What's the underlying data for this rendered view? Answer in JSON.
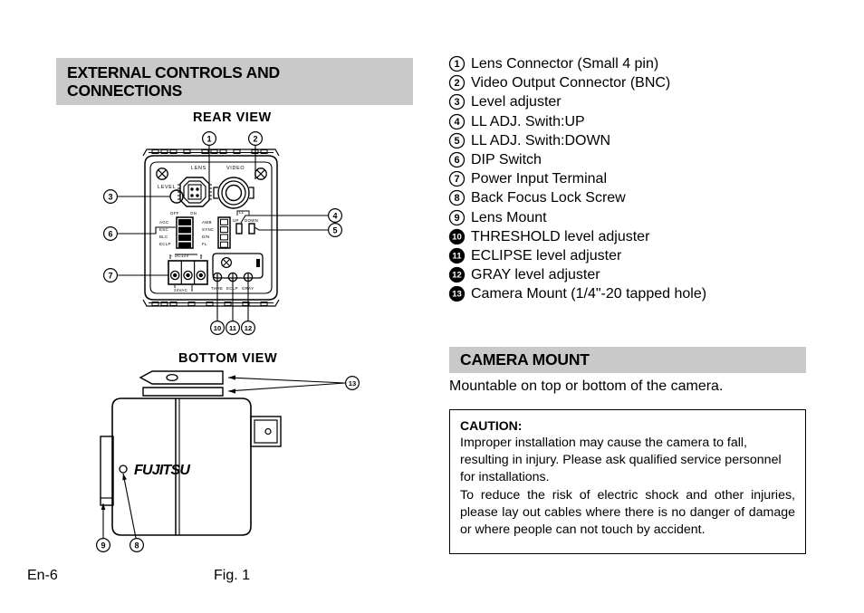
{
  "sections": {
    "external_controls": {
      "title": "EXTERNAL CONTROLS AND\nCONNECTIONS"
    },
    "camera_mount": {
      "title": "CAMERA MOUNT",
      "description": "Mountable on top or bottom of the camera."
    }
  },
  "views": {
    "rear": {
      "caption": "REAR  VIEW"
    },
    "bottom": {
      "caption": "BOTTOM  VIEW"
    }
  },
  "parts_list": [
    {
      "num": "1",
      "label": "Lens Connector (Small 4 pin)"
    },
    {
      "num": "2",
      "label": "Video Output Connector (BNC)"
    },
    {
      "num": "3",
      "label": "Level adjuster"
    },
    {
      "num": "4",
      "label": "LL ADJ. Swith:UP"
    },
    {
      "num": "5",
      "label": "LL ADJ. Swith:DOWN"
    },
    {
      "num": "6",
      "label": "DIP Switch"
    },
    {
      "num": "7",
      "label": "Power Input Terminal"
    },
    {
      "num": "8",
      "label": "Back Focus Lock Screw"
    },
    {
      "num": "9",
      "label": "Lens Mount"
    },
    {
      "num": "10",
      "label": "THRESHOLD level adjuster"
    },
    {
      "num": "11",
      "label": "ECLIPSE level adjuster"
    },
    {
      "num": "12",
      "label": "GRAY level adjuster"
    },
    {
      "num": "13",
      "label": "Camera Mount (1/4\"-20 tapped hole)"
    }
  ],
  "caution": {
    "title": "CAUTION:",
    "paragraph1": "Improper installation may cause the camera to fall, resulting in injury. Please ask qualified service personnel for installations.",
    "paragraph2": "To reduce the risk of electric shock and other injuries, please lay out cables where there is no danger of damage or where people can not touch by accident."
  },
  "diagram_labels": {
    "rear": {
      "lens": "LENS",
      "video": "VIDEO",
      "level": "LEVEL",
      "dip_off": "OFF",
      "dip_on": "ON",
      "dip_rows": [
        "AGC",
        "ESC",
        "BLC",
        "ECLP"
      ],
      "mode_rows": [
        "AWB",
        "SYNC",
        "D/N",
        "FL"
      ],
      "power_dc": "DC12V",
      "power_ac": "24VAC",
      "power_minus": "–",
      "power_plus": "+",
      "ll_adj": "LL",
      "ll_up": "UP",
      "ll_down": "DOWN",
      "pots": [
        "THRE",
        "ECLP",
        "GRAY"
      ]
    },
    "bottom": {
      "brand": "FUJITSU"
    }
  },
  "callouts": {
    "rear": [
      "1",
      "2",
      "3",
      "4",
      "5",
      "6",
      "7",
      "10",
      "11",
      "12"
    ],
    "bottom": [
      "8",
      "9",
      "13"
    ]
  },
  "footer": {
    "page": "En-6",
    "figure": "Fig. 1"
  },
  "colors": {
    "section_bar": "#c9c9c9",
    "text": "#000000",
    "background": "#ffffff"
  }
}
